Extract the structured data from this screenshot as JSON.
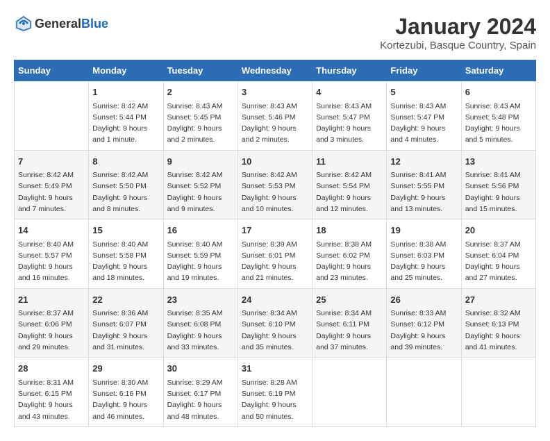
{
  "header": {
    "logo_general": "General",
    "logo_blue": "Blue",
    "title": "January 2024",
    "subtitle": "Kortezubi, Basque Country, Spain"
  },
  "days_of_week": [
    "Sunday",
    "Monday",
    "Tuesday",
    "Wednesday",
    "Thursday",
    "Friday",
    "Saturday"
  ],
  "weeks": [
    [
      {
        "day": "",
        "info": ""
      },
      {
        "day": "1",
        "info": "Sunrise: 8:42 AM\nSunset: 5:44 PM\nDaylight: 9 hours\nand 1 minute."
      },
      {
        "day": "2",
        "info": "Sunrise: 8:43 AM\nSunset: 5:45 PM\nDaylight: 9 hours\nand 2 minutes."
      },
      {
        "day": "3",
        "info": "Sunrise: 8:43 AM\nSunset: 5:46 PM\nDaylight: 9 hours\nand 2 minutes."
      },
      {
        "day": "4",
        "info": "Sunrise: 8:43 AM\nSunset: 5:47 PM\nDaylight: 9 hours\nand 3 minutes."
      },
      {
        "day": "5",
        "info": "Sunrise: 8:43 AM\nSunset: 5:47 PM\nDaylight: 9 hours\nand 4 minutes."
      },
      {
        "day": "6",
        "info": "Sunrise: 8:43 AM\nSunset: 5:48 PM\nDaylight: 9 hours\nand 5 minutes."
      }
    ],
    [
      {
        "day": "7",
        "info": "Sunrise: 8:42 AM\nSunset: 5:49 PM\nDaylight: 9 hours\nand 7 minutes."
      },
      {
        "day": "8",
        "info": "Sunrise: 8:42 AM\nSunset: 5:50 PM\nDaylight: 9 hours\nand 8 minutes."
      },
      {
        "day": "9",
        "info": "Sunrise: 8:42 AM\nSunset: 5:52 PM\nDaylight: 9 hours\nand 9 minutes."
      },
      {
        "day": "10",
        "info": "Sunrise: 8:42 AM\nSunset: 5:53 PM\nDaylight: 9 hours\nand 10 minutes."
      },
      {
        "day": "11",
        "info": "Sunrise: 8:42 AM\nSunset: 5:54 PM\nDaylight: 9 hours\nand 12 minutes."
      },
      {
        "day": "12",
        "info": "Sunrise: 8:41 AM\nSunset: 5:55 PM\nDaylight: 9 hours\nand 13 minutes."
      },
      {
        "day": "13",
        "info": "Sunrise: 8:41 AM\nSunset: 5:56 PM\nDaylight: 9 hours\nand 15 minutes."
      }
    ],
    [
      {
        "day": "14",
        "info": "Sunrise: 8:40 AM\nSunset: 5:57 PM\nDaylight: 9 hours\nand 16 minutes."
      },
      {
        "day": "15",
        "info": "Sunrise: 8:40 AM\nSunset: 5:58 PM\nDaylight: 9 hours\nand 18 minutes."
      },
      {
        "day": "16",
        "info": "Sunrise: 8:40 AM\nSunset: 5:59 PM\nDaylight: 9 hours\nand 19 minutes."
      },
      {
        "day": "17",
        "info": "Sunrise: 8:39 AM\nSunset: 6:01 PM\nDaylight: 9 hours\nand 21 minutes."
      },
      {
        "day": "18",
        "info": "Sunrise: 8:38 AM\nSunset: 6:02 PM\nDaylight: 9 hours\nand 23 minutes."
      },
      {
        "day": "19",
        "info": "Sunrise: 8:38 AM\nSunset: 6:03 PM\nDaylight: 9 hours\nand 25 minutes."
      },
      {
        "day": "20",
        "info": "Sunrise: 8:37 AM\nSunset: 6:04 PM\nDaylight: 9 hours\nand 27 minutes."
      }
    ],
    [
      {
        "day": "21",
        "info": "Sunrise: 8:37 AM\nSunset: 6:06 PM\nDaylight: 9 hours\nand 29 minutes."
      },
      {
        "day": "22",
        "info": "Sunrise: 8:36 AM\nSunset: 6:07 PM\nDaylight: 9 hours\nand 31 minutes."
      },
      {
        "day": "23",
        "info": "Sunrise: 8:35 AM\nSunset: 6:08 PM\nDaylight: 9 hours\nand 33 minutes."
      },
      {
        "day": "24",
        "info": "Sunrise: 8:34 AM\nSunset: 6:10 PM\nDaylight: 9 hours\nand 35 minutes."
      },
      {
        "day": "25",
        "info": "Sunrise: 8:34 AM\nSunset: 6:11 PM\nDaylight: 9 hours\nand 37 minutes."
      },
      {
        "day": "26",
        "info": "Sunrise: 8:33 AM\nSunset: 6:12 PM\nDaylight: 9 hours\nand 39 minutes."
      },
      {
        "day": "27",
        "info": "Sunrise: 8:32 AM\nSunset: 6:13 PM\nDaylight: 9 hours\nand 41 minutes."
      }
    ],
    [
      {
        "day": "28",
        "info": "Sunrise: 8:31 AM\nSunset: 6:15 PM\nDaylight: 9 hours\nand 43 minutes."
      },
      {
        "day": "29",
        "info": "Sunrise: 8:30 AM\nSunset: 6:16 PM\nDaylight: 9 hours\nand 46 minutes."
      },
      {
        "day": "30",
        "info": "Sunrise: 8:29 AM\nSunset: 6:17 PM\nDaylight: 9 hours\nand 48 minutes."
      },
      {
        "day": "31",
        "info": "Sunrise: 8:28 AM\nSunset: 6:19 PM\nDaylight: 9 hours\nand 50 minutes."
      },
      {
        "day": "",
        "info": ""
      },
      {
        "day": "",
        "info": ""
      },
      {
        "day": "",
        "info": ""
      }
    ]
  ]
}
